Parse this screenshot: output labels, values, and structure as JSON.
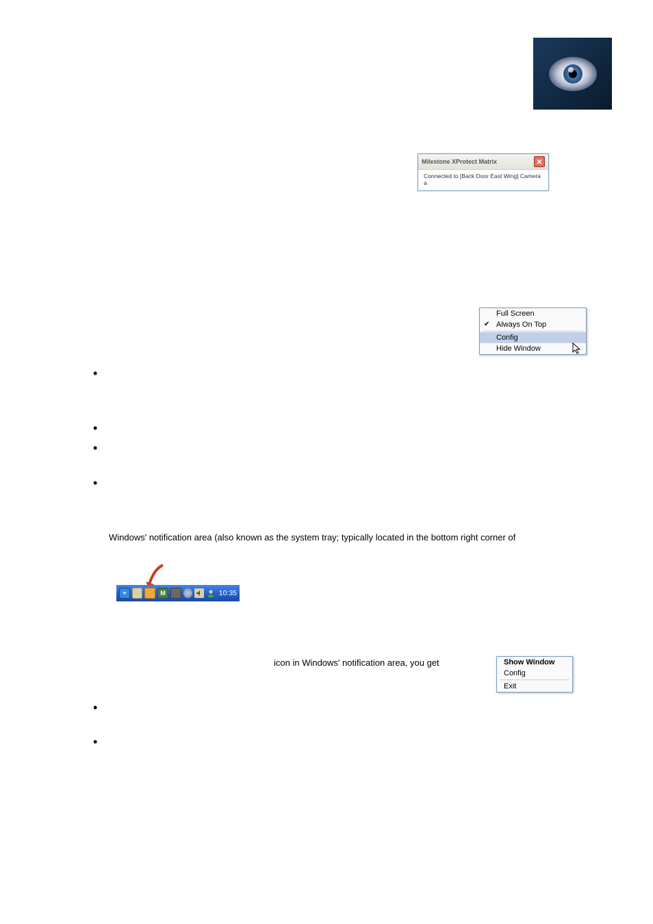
{
  "matrix_window": {
    "title": "Milestone XProtect Matrix",
    "body": "Connected to [Back Door East Wing] Camera a"
  },
  "ctx1": {
    "items": [
      {
        "label": "Full Screen",
        "checked": false
      },
      {
        "label": "Always On Top",
        "checked": true
      },
      {
        "label": "Config",
        "hover": true
      },
      {
        "label": "Hide Window",
        "checked": false
      }
    ]
  },
  "text_line1": "Windows' notification area (also known as the system tray; typically located in the bottom right corner of",
  "text_line2": "icon in Windows' notification area, you get",
  "tray": {
    "time": "10:35"
  },
  "ctx2": {
    "items": [
      {
        "label": "Show Window",
        "bold": true
      },
      {
        "label": "Config"
      },
      {
        "label": "Exit"
      }
    ]
  }
}
